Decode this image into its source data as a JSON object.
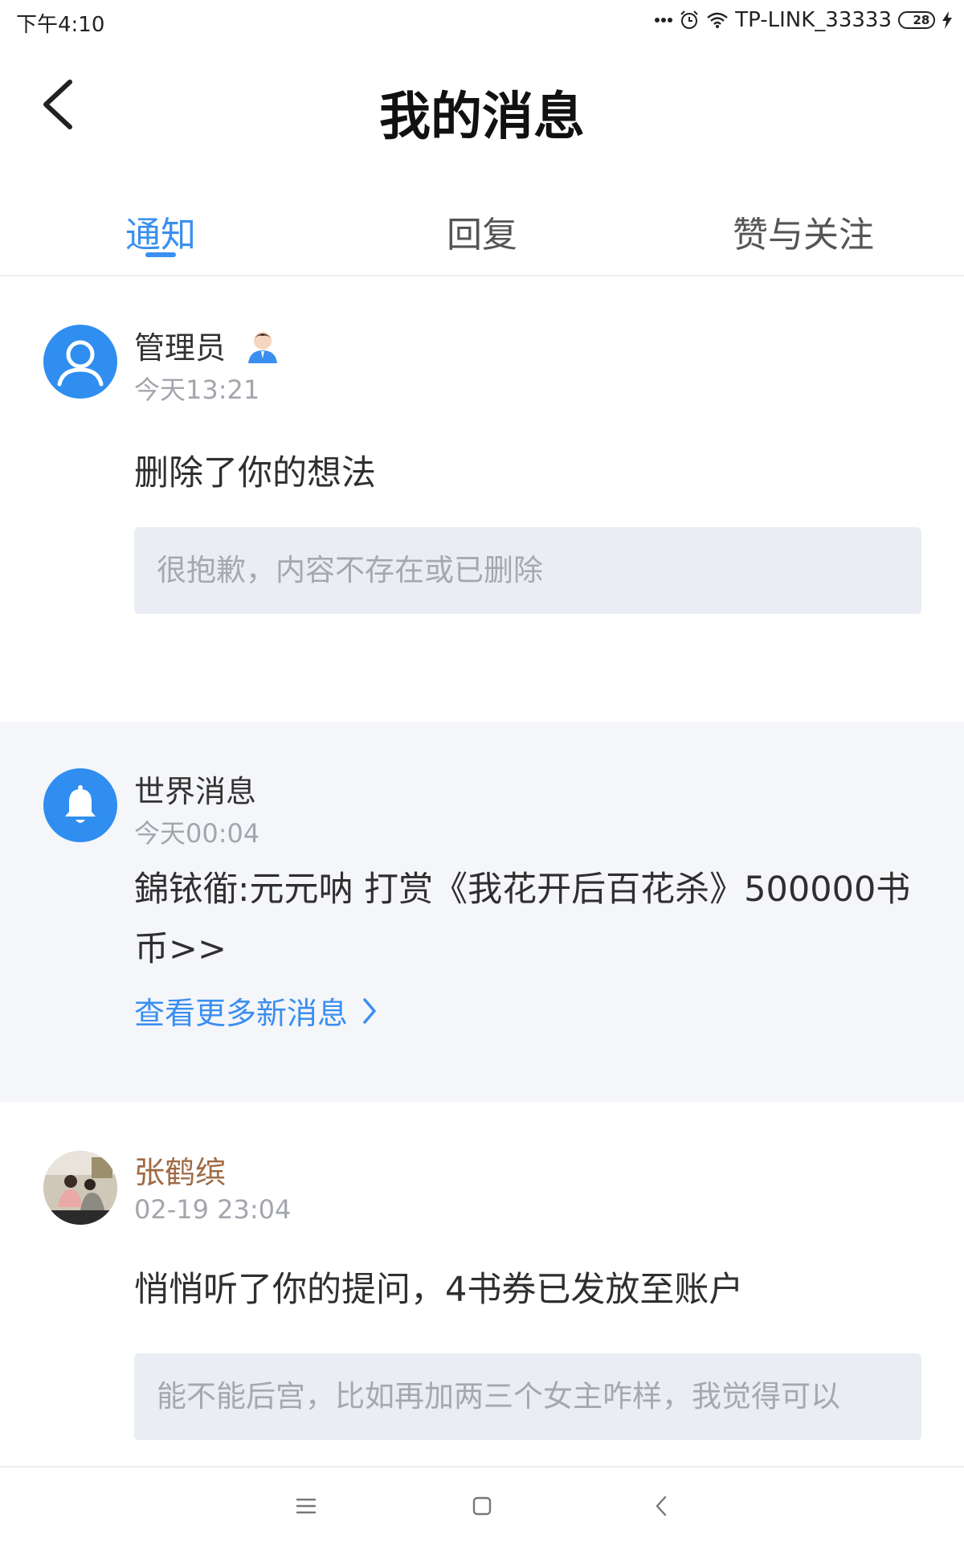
{
  "status_bar": {
    "time": "下午4:10",
    "wifi_name": "TP-LINK_33333",
    "battery_level": "28",
    "battery_fraction": 0.28,
    "icons": [
      "more-dots-icon",
      "alarm-icon",
      "wifi-icon",
      "battery-icon",
      "charging-icon"
    ]
  },
  "header": {
    "title": "我的消息",
    "back_icon": "chevron-left-icon"
  },
  "tabs": [
    {
      "label": "通知",
      "active": true
    },
    {
      "label": "回复",
      "active": false
    },
    {
      "label": "赞与关注",
      "active": false
    }
  ],
  "messages": [
    {
      "sender": "管理员",
      "sender_badge_icon": "admin-badge-icon",
      "avatar_icon": "user-avatar-icon",
      "time": "今天13:21",
      "text": "删除了你的想法",
      "quote": "很抱歉，内容不存在或已删除"
    },
    {
      "sender": "世界消息",
      "avatar_icon": "bell-icon",
      "time": "今天00:04",
      "text": "錦铱衜:元元呐 打赏《我花开后百花杀》500000书币>>",
      "link": "查看更多新消息"
    },
    {
      "sender": "张鹤缤",
      "avatar_icon": "photo-avatar",
      "time": "02-19 23:04",
      "text": "悄悄听了你的提问，4书券已发放至账户",
      "quote": "能不能后宫，比如再加两三个女主咋样，我觉得可以"
    }
  ],
  "colors": {
    "accent": "#3a8ff0",
    "brown_name": "#a06a45",
    "quote_bg": "#eaedf3",
    "highlight_bg": "#f5f6fa"
  },
  "nav_bar": {
    "icons": [
      "menu-icon",
      "home-square-icon",
      "back-triangle-icon"
    ]
  }
}
